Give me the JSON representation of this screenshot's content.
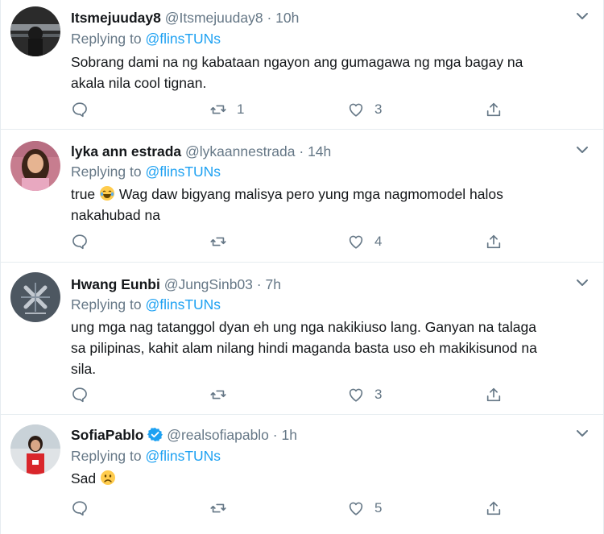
{
  "colors": {
    "link": "#1da1f2",
    "muted": "#657786",
    "text": "#14171a",
    "divider": "#e6ecf0",
    "verified": "#1da1f2"
  },
  "tweets": [
    {
      "name": "Itsmejuuday8",
      "handle": "@Itsmejuuday8",
      "dot": "·",
      "time": "10h",
      "replying_prefix": "Replying to",
      "replying_to": "@flinsTUNs",
      "lines": [
        "Sobrang dami na ng kabataan ngayon ang gumagawa ng mga bagay na",
        "akala nila cool tignan."
      ],
      "retweets": "1",
      "likes": "3",
      "verified": false
    },
    {
      "name": "lyka ann estrada",
      "handle": "@lykaannestrada",
      "dot": "·",
      "time": "14h",
      "replying_prefix": "Replying to",
      "replying_to": "@flinsTUNs",
      "text_before_emoji": "true",
      "emoji": "joy-emoji",
      "text_after_emoji": "Wag daw bigyang malisya pero yung mga nagmomodel halos",
      "lines": [
        "nakahubad na"
      ],
      "retweets": "",
      "likes": "4",
      "verified": false
    },
    {
      "name": "Hwang Eunbi",
      "handle": "@JungSinb03",
      "dot": "·",
      "time": "7h",
      "replying_prefix": "Replying to",
      "replying_to": "@flinsTUNs",
      "lines": [
        "ung mga nag tatanggol dyan eh ung nga nakikiuso lang. Ganyan na talaga",
        "sa pilipinas, kahit alam nilang hindi maganda basta uso eh makikisunod na",
        "sila."
      ],
      "retweets": "",
      "likes": "3",
      "verified": false
    },
    {
      "name": "SofiaPablo",
      "handle": "@realsofiapablo",
      "dot": "·",
      "time": "1h",
      "replying_prefix": "Replying to",
      "replying_to": "@flinsTUNs",
      "text_before_emoji": "Sad",
      "emoji": "frowning-emoji",
      "lines": [],
      "retweets": "",
      "likes": "5",
      "verified": true
    }
  ]
}
